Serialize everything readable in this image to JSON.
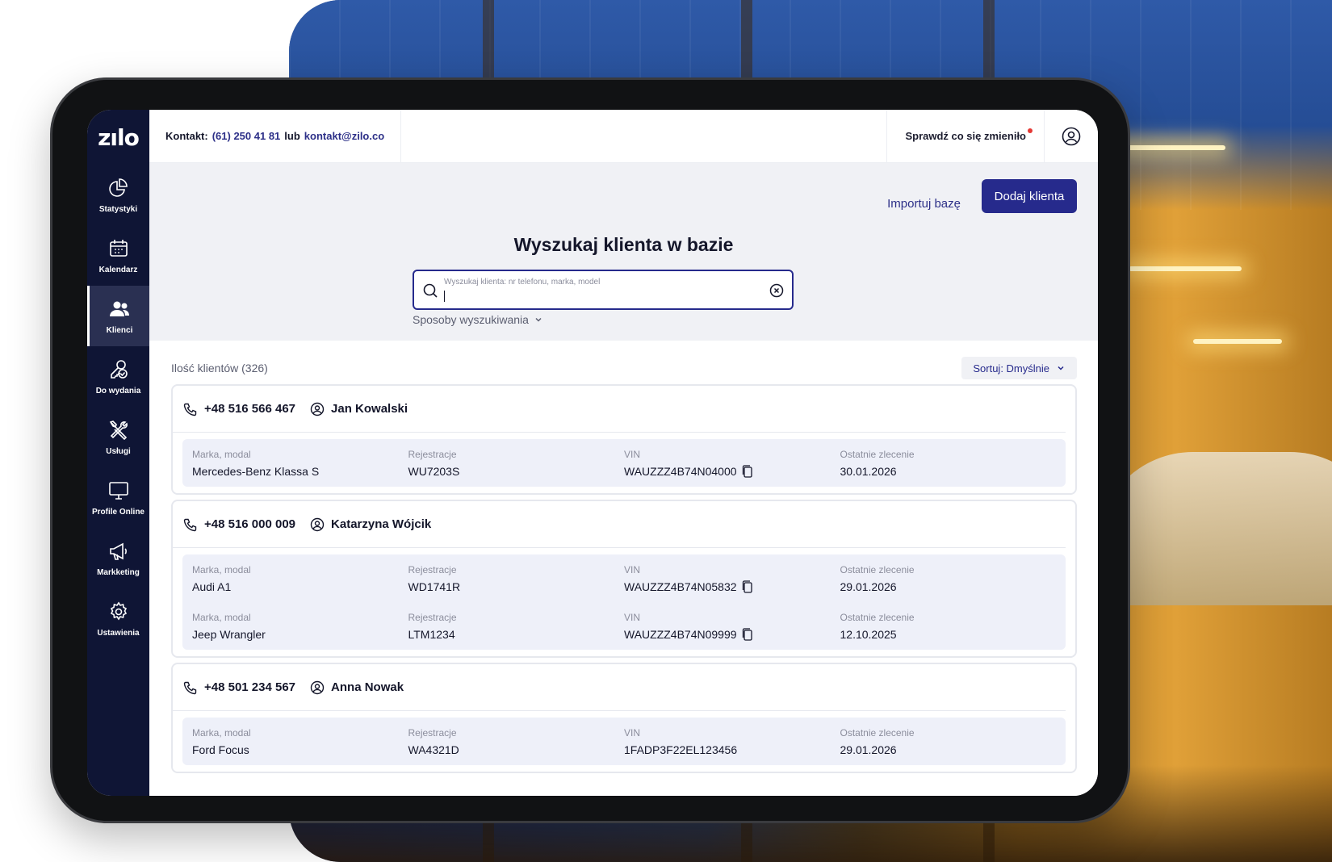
{
  "brand": {
    "logo_text": "zılo",
    "accent_color": "#262a8c",
    "sidebar_color": "#0f1535"
  },
  "sidebar": {
    "items": [
      {
        "label": "Statystyki",
        "icon": "pie-chart-icon"
      },
      {
        "label": "Kalendarz",
        "icon": "calendar-icon"
      },
      {
        "label": "Klienci",
        "icon": "users-icon",
        "active": true
      },
      {
        "label": "Do wydania",
        "icon": "key-check-icon"
      },
      {
        "label": "Usługi",
        "icon": "tools-icon"
      },
      {
        "label": "Profile Online",
        "icon": "monitor-icon"
      },
      {
        "label": "Markketing",
        "icon": "megaphone-icon"
      },
      {
        "label": "Ustawienia",
        "icon": "gear-icon"
      }
    ]
  },
  "topbar": {
    "contact_label": "Kontakt:",
    "phone": "(61) 250 41 81",
    "or_text": "lub",
    "email": "kontakt@zilo.co",
    "whats_new": "Sprawdź co się zmieniło",
    "user_icon": "user-circle-icon"
  },
  "actions": {
    "import_label": "Importuj bazę",
    "add_label": "Dodaj klienta"
  },
  "search": {
    "title": "Wyszukaj klienta w bazie",
    "placeholder": "Wyszukaj klienta: nr telefonu, marka, model",
    "value": "",
    "methods_label": "Sposoby wyszukiwania"
  },
  "list": {
    "count_label": "Ilość klientów (326)",
    "sort_label": "Sortuj: Dmyślnie",
    "columns": {
      "model": "Marka, modal",
      "registration": "Rejestracje",
      "vin": "VIN",
      "last_order": "Ostatnie zlecenie"
    },
    "clients": [
      {
        "phone": "+48 516 566 467",
        "name": "Jan Kowalski",
        "vehicles": [
          {
            "model": "Mercedes-Benz Klassa S",
            "registration": "WU7203S",
            "vin": "WAUZZZ4B74N04000",
            "last_order": "30.01.2026"
          }
        ]
      },
      {
        "phone": "+48 516 000 009",
        "name": "Katarzyna Wójcik",
        "vehicles": [
          {
            "model": "Audi A1",
            "registration": "WD1741R",
            "vin": "WAUZZZ4B74N05832",
            "last_order": "29.01.2026"
          },
          {
            "model": "Jeep Wrangler",
            "registration": "LTM1234",
            "vin": "WAUZZZ4B74N09999",
            "last_order": "12.10.2025"
          }
        ]
      },
      {
        "phone": "+48 501 234 567",
        "name": "Anna Nowak",
        "vehicles": [
          {
            "model": "Ford Focus",
            "registration": "WA4321D",
            "vin": "1FADP3F22EL123456",
            "last_order": "29.01.2026"
          }
        ]
      }
    ]
  }
}
